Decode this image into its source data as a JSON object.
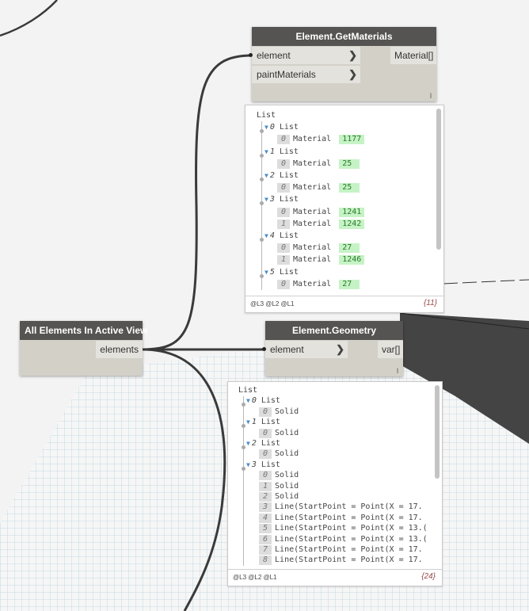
{
  "nodes": {
    "get_materials": {
      "title": "Element.GetMaterials",
      "inputs": [
        "element",
        "paintMaterials"
      ],
      "output": "Material[]",
      "lacing": "l"
    },
    "all_elements": {
      "title": "All Elements In Active View",
      "output": "elements"
    },
    "geometry": {
      "title": "Element.Geometry",
      "input": "element",
      "output": "var[]",
      "lacing": "l"
    }
  },
  "watch_materials": {
    "root": "List",
    "rows": [
      {
        "kind": "list",
        "level": 1,
        "index": "0",
        "label": "List"
      },
      {
        "kind": "item",
        "level": 2,
        "index": "0",
        "label": "Material",
        "value": "1177"
      },
      {
        "kind": "list",
        "level": 1,
        "index": "1",
        "label": "List"
      },
      {
        "kind": "item",
        "level": 2,
        "index": "0",
        "label": "Material",
        "value": "25"
      },
      {
        "kind": "list",
        "level": 1,
        "index": "2",
        "label": "List"
      },
      {
        "kind": "item",
        "level": 2,
        "index": "0",
        "label": "Material",
        "value": "25"
      },
      {
        "kind": "list",
        "level": 1,
        "index": "3",
        "label": "List"
      },
      {
        "kind": "item",
        "level": 2,
        "index": "0",
        "label": "Material",
        "value": "1241"
      },
      {
        "kind": "item",
        "level": 2,
        "index": "1",
        "label": "Material",
        "value": "1242"
      },
      {
        "kind": "list",
        "level": 1,
        "index": "4",
        "label": "List"
      },
      {
        "kind": "item",
        "level": 2,
        "index": "0",
        "label": "Material",
        "value": "27"
      },
      {
        "kind": "item",
        "level": 2,
        "index": "1",
        "label": "Material",
        "value": "1246"
      },
      {
        "kind": "list",
        "level": 1,
        "index": "5",
        "label": "List"
      },
      {
        "kind": "item",
        "level": 2,
        "index": "0",
        "label": "Material",
        "value": "27"
      }
    ],
    "levels": "@L3 @L2 @L1",
    "count": "{11}"
  },
  "watch_geometry": {
    "root": "List",
    "rows": [
      {
        "kind": "list",
        "level": 1,
        "index": "0",
        "label": "List"
      },
      {
        "kind": "item",
        "level": 2,
        "index": "0",
        "label": "Solid"
      },
      {
        "kind": "list",
        "level": 1,
        "index": "1",
        "label": "List"
      },
      {
        "kind": "item",
        "level": 2,
        "index": "0",
        "label": "Solid"
      },
      {
        "kind": "list",
        "level": 1,
        "index": "2",
        "label": "List"
      },
      {
        "kind": "item",
        "level": 2,
        "index": "0",
        "label": "Solid"
      },
      {
        "kind": "list",
        "level": 1,
        "index": "3",
        "label": "List"
      },
      {
        "kind": "item",
        "level": 2,
        "index": "0",
        "label": "Solid"
      },
      {
        "kind": "item",
        "level": 2,
        "index": "1",
        "label": "Solid"
      },
      {
        "kind": "item",
        "level": 2,
        "index": "2",
        "label": "Solid"
      },
      {
        "kind": "item",
        "level": 2,
        "index": "3",
        "label": "Line(StartPoint = Point(X = 17."
      },
      {
        "kind": "item",
        "level": 2,
        "index": "4",
        "label": "Line(StartPoint = Point(X = 17."
      },
      {
        "kind": "item",
        "level": 2,
        "index": "5",
        "label": "Line(StartPoint = Point(X = 13.("
      },
      {
        "kind": "item",
        "level": 2,
        "index": "6",
        "label": "Line(StartPoint = Point(X = 13.("
      },
      {
        "kind": "item",
        "level": 2,
        "index": "7",
        "label": "Line(StartPoint = Point(X = 17."
      },
      {
        "kind": "item",
        "level": 2,
        "index": "8",
        "label": "Line(StartPoint = Point(X = 17."
      }
    ],
    "levels": "@L3 @L2 @L1",
    "count": "{24}"
  },
  "colors": {
    "node_header": "#555453",
    "node_body": "#d3d0c8",
    "wire": "#3a3a3a",
    "value_bg": "#c6f3c6",
    "grid": "#9ec3d4"
  }
}
